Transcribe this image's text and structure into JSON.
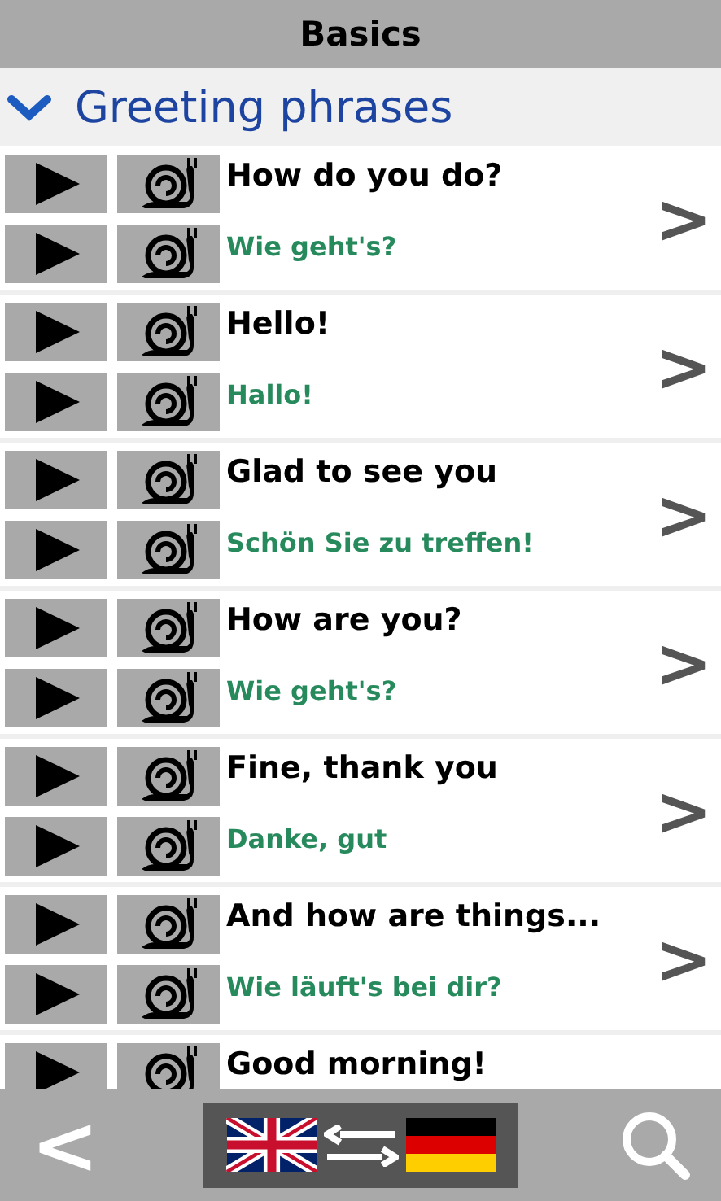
{
  "header": {
    "title": "Basics"
  },
  "section": {
    "title": "Greeting phrases",
    "expanded": true
  },
  "phrases": [
    {
      "english": "How do you do?",
      "german": "Wie geht's?",
      "chevron": ">"
    },
    {
      "english": "Hello!",
      "german": "Hallo!",
      "chevron": ">"
    },
    {
      "english": "Glad to see you",
      "german": "Schön Sie zu treffen!",
      "chevron": ">"
    },
    {
      "english": "How are you?",
      "german": "Wie geht's?",
      "chevron": ">"
    },
    {
      "english": "Fine, thank you",
      "german": "Danke, gut",
      "chevron": ">"
    },
    {
      "english": "And how are things...",
      "german": "Wie läuft's bei dir?",
      "chevron": ">"
    },
    {
      "english": "Good morning!"
    }
  ],
  "bottom_bar": {
    "back": "<"
  }
}
